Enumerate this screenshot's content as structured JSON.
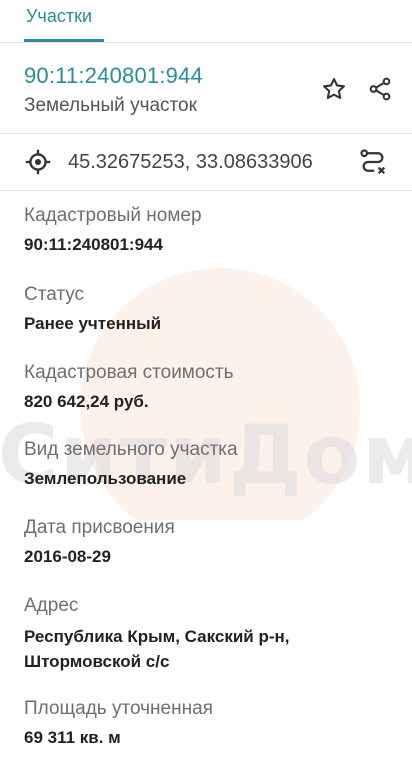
{
  "tabs": [
    {
      "label": "Участки",
      "active": true
    }
  ],
  "parcel": {
    "id": "90:11:240801:944",
    "type": "Земельный участок"
  },
  "actions": {
    "favorite_icon": "star-outline-icon",
    "share_icon": "share-icon"
  },
  "location": {
    "icon": "gps-target-icon",
    "coordinates": "45.32675253, 33.08633906",
    "route_icon": "route-icon"
  },
  "details": {
    "cadastral_number": {
      "label": "Кадастровый номер",
      "value": "90:11:240801:944"
    },
    "status": {
      "label": "Статус",
      "value": "Ранее учтенный"
    },
    "cadastral_value": {
      "label": "Кадастровая стоимость",
      "value": "820 642,24 руб."
    },
    "land_use": {
      "label": "Вид земельного участка",
      "value": "Землепользование"
    },
    "assign_date": {
      "label": "Дата присвоения",
      "value": "2016-08-29"
    },
    "address": {
      "label": "Адрес",
      "line1": "Республика Крым, Сакский р-н,",
      "line2": "Штормовской с/с"
    },
    "area": {
      "label": "Площадь уточненная",
      "value": "69 311 кв. м"
    }
  },
  "watermark": {
    "text": "СитиДом"
  },
  "colors": {
    "accent": "#2e8b9a",
    "text": "#212121",
    "label": "#6f6f6f"
  }
}
